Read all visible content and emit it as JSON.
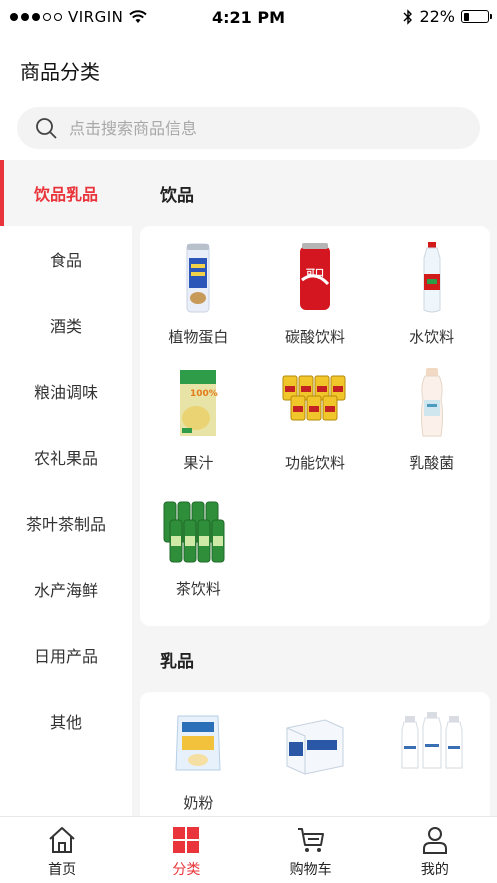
{
  "status_bar": {
    "carrier": "VIRGIN",
    "time": "4:21 PM",
    "battery": "22%",
    "battery_level": 0.22
  },
  "header": {
    "title": "商品分类"
  },
  "search": {
    "placeholder": "点击搜索商品信息"
  },
  "sidebar": {
    "items": [
      {
        "label": "饮品乳品",
        "active": true
      },
      {
        "label": "食品"
      },
      {
        "label": "酒类"
      },
      {
        "label": "粮油调味"
      },
      {
        "label": "农礼果品"
      },
      {
        "label": "茶叶茶制品"
      },
      {
        "label": "水产海鲜"
      },
      {
        "label": "日用产品"
      },
      {
        "label": "其他"
      }
    ]
  },
  "sections": [
    {
      "title": "饮品",
      "items": [
        {
          "label": "植物蛋白",
          "icon": "walnut-milk-can"
        },
        {
          "label": "碳酸饮料",
          "icon": "cola-can"
        },
        {
          "label": "水饮料",
          "icon": "water-bottle"
        },
        {
          "label": "果汁",
          "icon": "juice-carton"
        },
        {
          "label": "功能饮料",
          "icon": "energy-drink-cans"
        },
        {
          "label": "乳酸菌",
          "icon": "yogurt-drink-bottle"
        },
        {
          "label": "茶饮料",
          "icon": "green-tea-bottles"
        }
      ]
    },
    {
      "title": "乳品",
      "items": [
        {
          "label": "奶粉",
          "icon": "milk-powder-bag"
        },
        {
          "label": "",
          "icon": "milk-box"
        },
        {
          "label": "",
          "icon": "milk-bottles"
        }
      ]
    }
  ],
  "tabbar": {
    "items": [
      {
        "label": "首页",
        "icon": "home-icon"
      },
      {
        "label": "分类",
        "icon": "category-icon",
        "active": true
      },
      {
        "label": "购物车",
        "icon": "cart-icon"
      },
      {
        "label": "我的",
        "icon": "user-icon"
      }
    ]
  },
  "colors": {
    "accent": "#e8343a",
    "background": "#f5f5f5"
  }
}
